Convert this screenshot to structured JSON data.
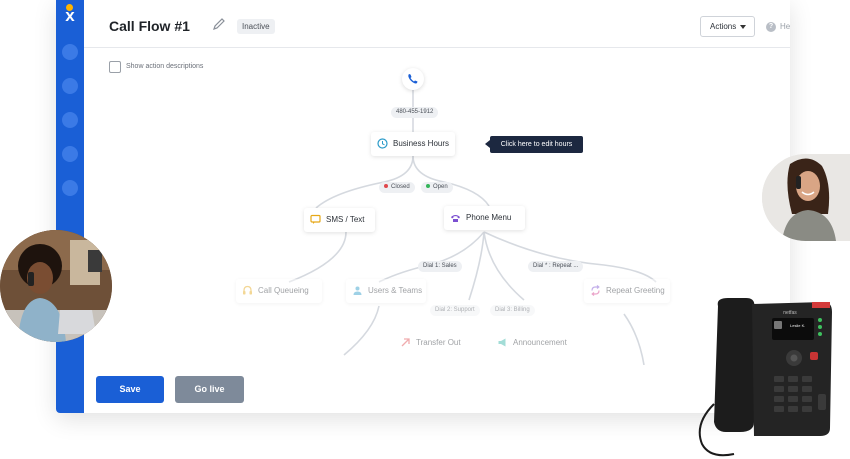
{
  "app": {
    "logo": "x",
    "title": "Call Flow #1",
    "status_badge": "Inactive",
    "actions_label": "Actions",
    "help_label": "Help",
    "help_icon_glyph": "?",
    "show_descriptions_label": "Show action descriptions",
    "colors": {
      "brand_blue": "#1a5fd6",
      "rail_dot": "#3b7ae6",
      "logo_accent": "#ffb400"
    }
  },
  "flow": {
    "phone_number": "480-455-1912",
    "tooltip": "Click here to edit hours",
    "nodes": {
      "business_hours": "Business Hours",
      "sms_text": "SMS / Text",
      "phone_menu": "Phone Menu",
      "call_queueing": "Call Queueing",
      "users_teams": "Users & Teams",
      "repeat_greeting": "Repeat Greeting",
      "transfer_out": "Transfer Out",
      "announcement": "Announcement"
    },
    "labels": {
      "closed": "Closed",
      "open": "Open",
      "dial_1": "Dial 1: Sales",
      "dial_star": "Dial * : Repeat ...",
      "dial_2": "Dial 2: Support",
      "dial_3": "Dial 3: Billing"
    },
    "label_colors": {
      "closed": "#e0484d",
      "open": "#35b55a"
    }
  },
  "footer": {
    "save_label": "Save",
    "golive_label": "Go live"
  },
  "deskphone": {
    "brand": "netfas",
    "screen_name": "Leslie K."
  }
}
